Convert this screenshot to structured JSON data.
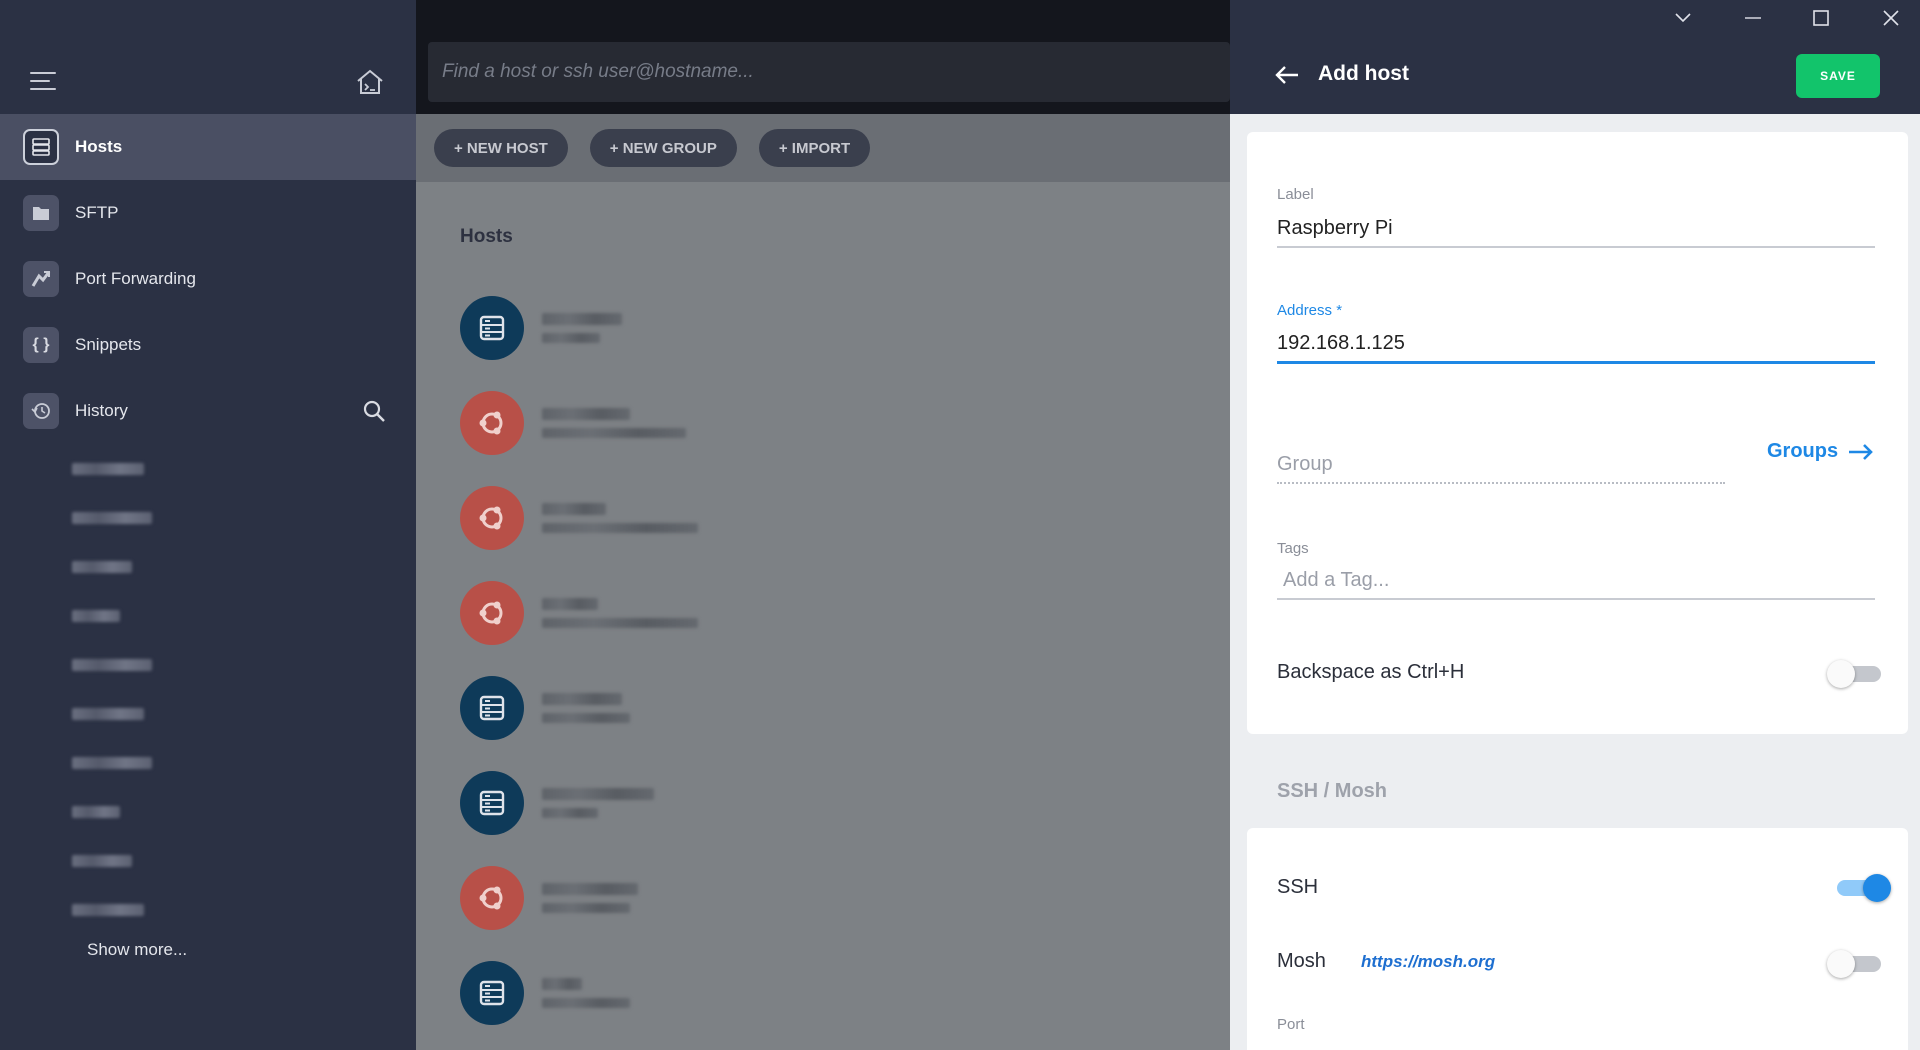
{
  "sidebar": {
    "items": [
      {
        "label": "Hosts",
        "icon": "hosts-icon"
      },
      {
        "label": "SFTP",
        "icon": "folder-icon"
      },
      {
        "label": "Port Forwarding",
        "icon": "port-forwarding-icon"
      },
      {
        "label": "Snippets",
        "icon": "braces-icon"
      },
      {
        "label": "History",
        "icon": "history-icon"
      }
    ],
    "show_more": "Show more..."
  },
  "search": {
    "placeholder": "Find a host or ssh user@hostname..."
  },
  "toolbar": {
    "new_host": "+ NEW HOST",
    "new_group": "+ NEW GROUP",
    "import": "+ IMPORT"
  },
  "main": {
    "section_title": "Hosts"
  },
  "panel": {
    "title": "Add host",
    "save_label": "SAVE",
    "label_field": {
      "label": "Label",
      "value": "Raspberry Pi"
    },
    "address_field": {
      "label": "Address *",
      "value": "192.168.1.125"
    },
    "group_field": {
      "placeholder": "Group"
    },
    "groups_link": "Groups",
    "tags_field": {
      "label": "Tags",
      "placeholder": "Add a Tag..."
    },
    "backspace_toggle": {
      "label": "Backspace as Ctrl+H",
      "on": false
    },
    "ssh_section_title": "SSH / Mosh",
    "ssh_toggle": {
      "label": "SSH",
      "on": true
    },
    "mosh_toggle": {
      "label": "Mosh",
      "link": "https://mosh.org",
      "on": false
    },
    "port_label": "Port"
  },
  "colors": {
    "accent": "#1e88e5",
    "save_green": "#12c46b",
    "sidebar_bg": "#2b3144",
    "server_avatar": "#0e3a59",
    "ubuntu_avatar": "#b85048"
  }
}
